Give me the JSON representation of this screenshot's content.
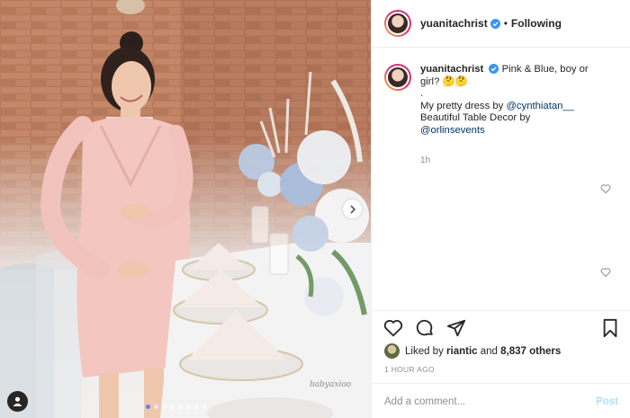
{
  "post": {
    "watermark": "babyaxioo",
    "carousel": {
      "count": 8,
      "active_index": 0
    }
  },
  "header": {
    "username": "yuanitachrist",
    "separator": "•",
    "follow_status": "Following"
  },
  "caption": {
    "username": "yuanitachrist",
    "line1": "Pink & Blue, boy or girl? 🤔🤔",
    "line2": ".",
    "line3_prefix": "My pretty dress by ",
    "mention1": "@cynthiatan__",
    "line4": "Beautiful Table Decor by",
    "mention2": "@orlinsevents",
    "time_ago": "1h"
  },
  "engagement": {
    "liked_by_prefix": "Liked by ",
    "liked_by_user": "riantic",
    "liked_by_connector": " and ",
    "liked_by_count": "8,837 others",
    "post_time": "1 HOUR AGO"
  },
  "comment_box": {
    "placeholder": "Add a comment...",
    "post_label": "Post"
  },
  "colors": {
    "verified_blue": "#3897f0",
    "mention_blue": "#00376b",
    "post_button_disabled": "#b2dffc"
  },
  "icons": [
    "verified-badge-icon",
    "heart-icon",
    "comment-icon",
    "share-icon",
    "bookmark-icon",
    "next-arrow-icon",
    "user-tag-icon",
    "small-heart-icon"
  ]
}
